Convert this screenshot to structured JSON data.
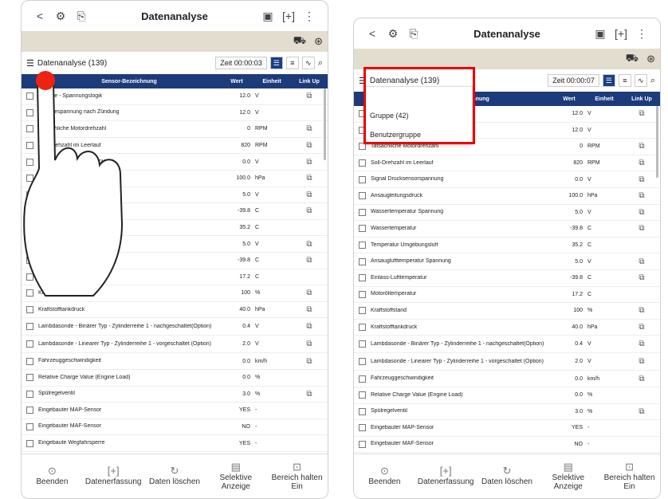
{
  "app": {
    "title": "Datenanalyse",
    "data_title": "Datenanalyse (139)",
    "time_left": "Zeit 00:00:03",
    "time_right": "Zeit 00:00:07"
  },
  "header": {
    "sensor": "Sensor-Bezeichnung",
    "wert": "Wert",
    "einheit": "Einheit",
    "linkup": "Link Up"
  },
  "popup": {
    "item1": "Gruppe (42)",
    "item2": "Benutzergruppe"
  },
  "rows": [
    {
      "name": "Batterie - Spannungslogik",
      "value": "12.0",
      "unit": "V",
      "link": true
    },
    {
      "name": "Batteriespannung nach Zündung",
      "value": "12.0",
      "unit": "V",
      "link": false
    },
    {
      "name": "Tatsächliche Motordrehzahl",
      "value": "0",
      "unit": "RPM",
      "link": true
    },
    {
      "name": "Soll-Drehzahl im Leerlauf",
      "value": "820",
      "unit": "RPM",
      "link": true
    },
    {
      "name": "Signal Drucksensorspannung",
      "value": "0.0",
      "unit": "V",
      "link": true
    },
    {
      "name": "Ansaugleitungsdruck",
      "value": "100.0",
      "unit": "hPa",
      "link": true
    },
    {
      "name": "Wassertemperatur Spannung",
      "value": "5.0",
      "unit": "V",
      "link": true
    },
    {
      "name": "Wassertemperatur",
      "value": "-39.8",
      "unit": "C",
      "link": true
    },
    {
      "name": "Temperatur Umgebungsluft",
      "value": "35.2",
      "unit": "C",
      "link": false
    },
    {
      "name": "Ansauglufttemperatur Spannung",
      "value": "5.0",
      "unit": "V",
      "link": true
    },
    {
      "name": "Einlass-Lufttemperatur",
      "value": "-39.8",
      "unit": "C",
      "link": true
    },
    {
      "name": "Motoröltemperatur",
      "value": "17.2",
      "unit": "C",
      "link": false
    },
    {
      "name": "Kraftstoffstand",
      "value": "100",
      "unit": "%",
      "link": true
    },
    {
      "name": "Kraftstofftankdruck",
      "value": "40.0",
      "unit": "hPa",
      "link": true
    },
    {
      "name": "Lambdasonde - Binärer Typ - Zylinderreihe 1 - nachgeschaltet(Option)",
      "value": "0.4",
      "unit": "V",
      "link": true
    },
    {
      "name": "Lambdasonde - Linearer Typ - Zylinderreihe 1 - vorgeschaltet (Option)",
      "value": "2.0",
      "unit": "V",
      "link": true
    },
    {
      "name": "Fahrzeuggeschwindigkeit",
      "value": "0.0",
      "unit": "km/h",
      "link": true
    },
    {
      "name": "Relative Charge Value (Engine Load)",
      "value": "0.0",
      "unit": "%",
      "link": false
    },
    {
      "name": "Spülregelventil",
      "value": "3.0",
      "unit": "%",
      "link": true
    },
    {
      "name": "Eingebauter MAP-Sensor",
      "value": "YES",
      "unit": "-",
      "link": false
    },
    {
      "name": "Eingebauter MAF-Sensor",
      "value": "NO",
      "unit": "-",
      "link": false
    },
    {
      "name": "Eingebaute Wegfahrsperre",
      "value": "YES",
      "unit": "-",
      "link": false
    }
  ],
  "bottom": [
    {
      "label": "Beenden",
      "icon": "⊙"
    },
    {
      "label": "Datenerfassung",
      "icon": "[+]"
    },
    {
      "label": "Daten löschen",
      "icon": "↻"
    },
    {
      "label": "Selektive Anzeige",
      "icon": "▤"
    },
    {
      "label": "Bereich halten Ein",
      "icon": "⊡"
    }
  ]
}
